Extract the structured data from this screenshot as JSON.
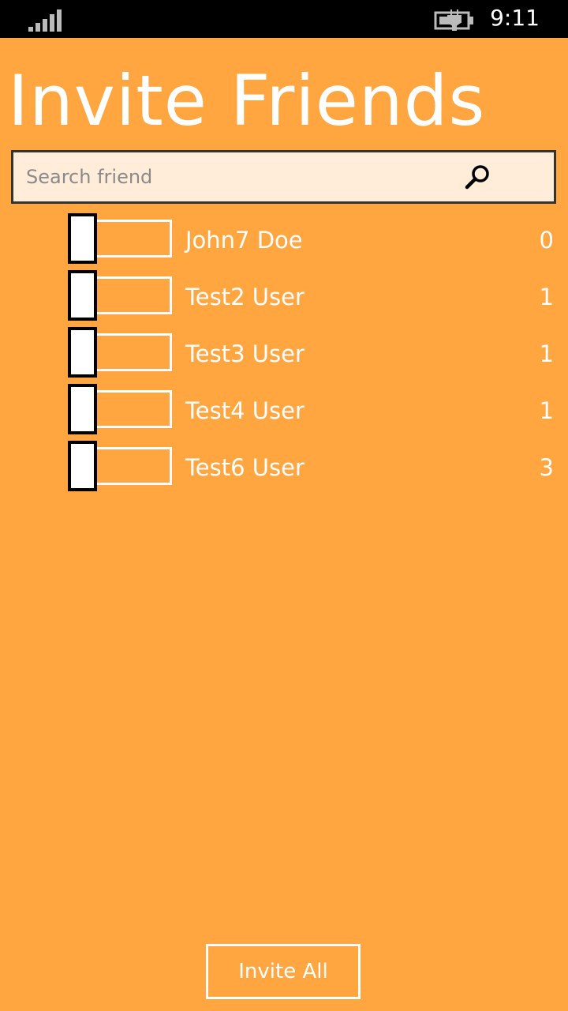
{
  "status_bar": {
    "time": "9:11",
    "signal_icon": "signal-strength-icon",
    "battery_icon": "battery-charging-icon"
  },
  "page": {
    "title": "Invite Friends",
    "background_color": "#FFA640"
  },
  "search": {
    "placeholder": "Search friend",
    "value": "",
    "icon": "search-icon"
  },
  "friends": [
    {
      "name": "John7 Doe",
      "count": "0",
      "invited": false
    },
    {
      "name": "Test2 User",
      "count": "1",
      "invited": false
    },
    {
      "name": "Test3 User",
      "count": "1",
      "invited": false
    },
    {
      "name": "Test4 User",
      "count": "1",
      "invited": false
    },
    {
      "name": "Test6 User",
      "count": "3",
      "invited": false
    }
  ],
  "footer": {
    "invite_all_label": "Invite All"
  }
}
